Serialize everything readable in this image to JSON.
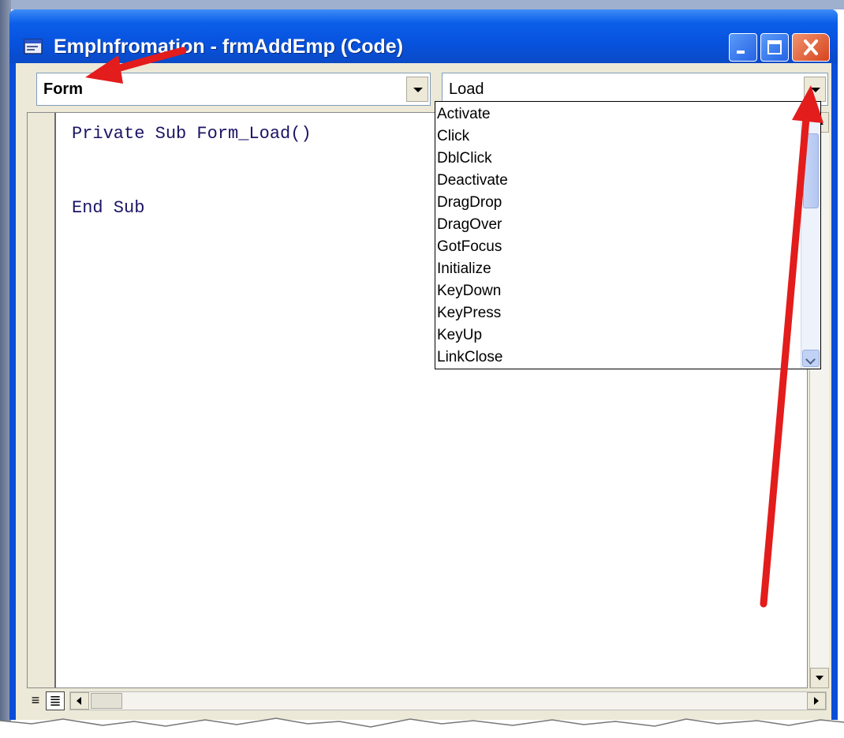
{
  "window": {
    "title": "EmpInfromation - frmAddEmp (Code)"
  },
  "object_combo": {
    "value": "Form"
  },
  "procedure_combo": {
    "value": "Load"
  },
  "code": {
    "lines": [
      "Private Sub Form_Load()",
      "End Sub"
    ]
  },
  "dropdown": {
    "items": [
      "Activate",
      "Click",
      "DblClick",
      "Deactivate",
      "DragDrop",
      "DragOver",
      "GotFocus",
      "Initialize",
      "KeyDown",
      "KeyPress",
      "KeyUp",
      "LinkClose"
    ]
  },
  "annotation_color": "#e31c1c",
  "icons": {
    "window": "window-icon",
    "minimize": "minimize-icon",
    "maximize": "maximize-icon",
    "close": "close-icon",
    "procedure_view": "procedure-view-icon",
    "full_module_view": "full-module-view-icon"
  }
}
